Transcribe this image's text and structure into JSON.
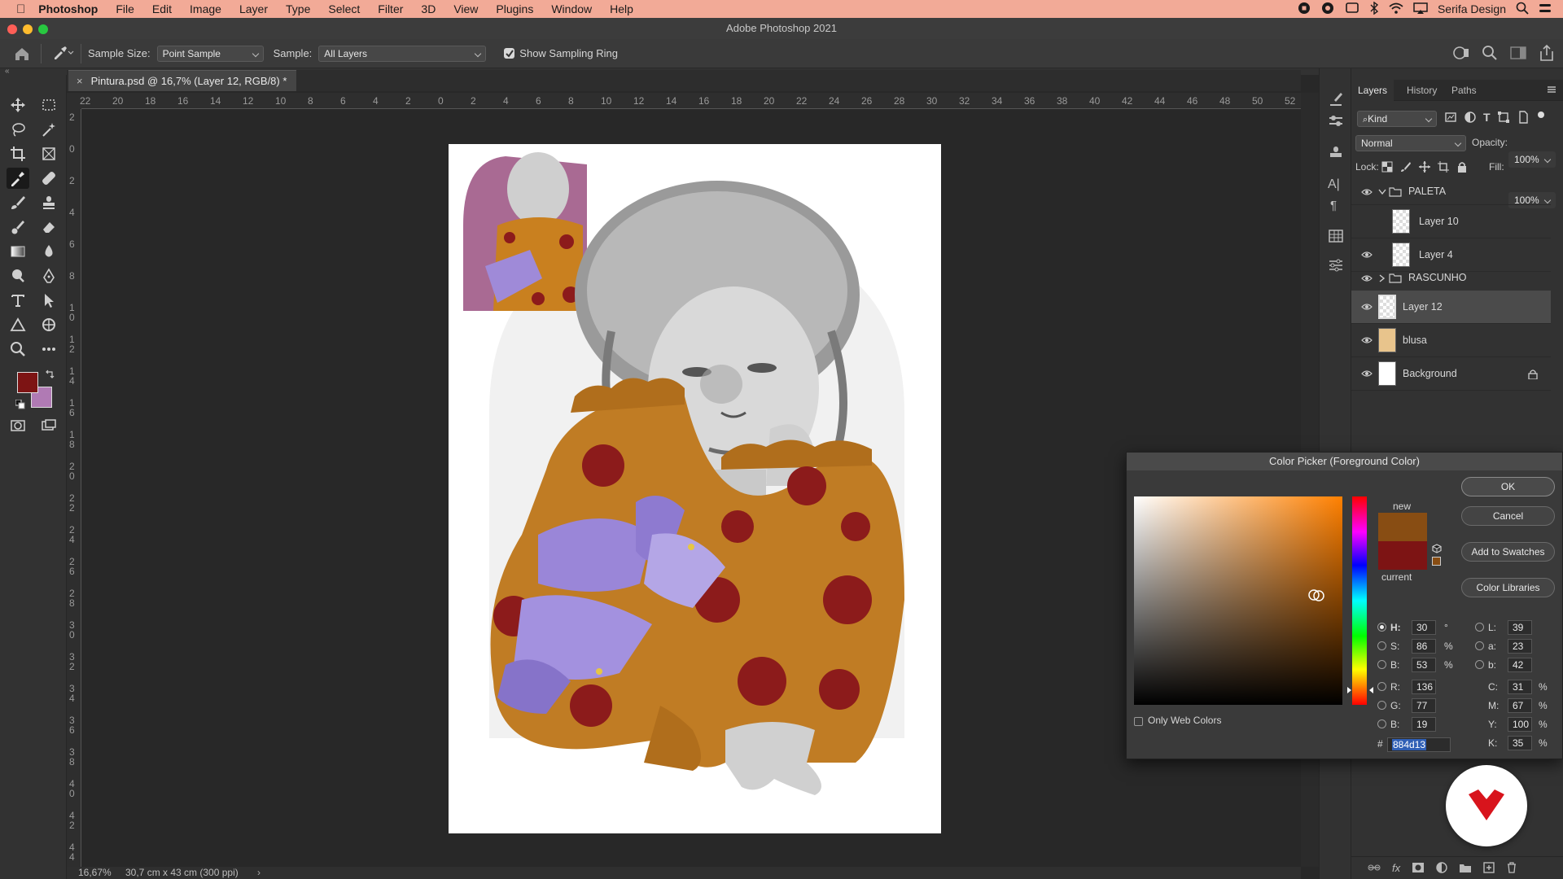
{
  "menubar": {
    "app_name": "Photoshop",
    "items": [
      "File",
      "Edit",
      "Image",
      "Layer",
      "Type",
      "Select",
      "Filter",
      "3D",
      "View",
      "Plugins",
      "Window",
      "Help"
    ],
    "user": "Serifa Design"
  },
  "window": {
    "title": "Adobe Photoshop 2021"
  },
  "options": {
    "sample_size_label": "Sample Size:",
    "sample_size_value": "Point Sample",
    "sample_label": "Sample:",
    "sample_value": "All Layers",
    "show_ring_label": "Show Sampling Ring",
    "show_ring_checked": true
  },
  "document": {
    "tab_label": "Pintura.psd @ 16,7% (Layer 12, RGB/8) *",
    "zoom": "16,67%",
    "size_info": "30,7 cm x 43 cm (300 ppi)"
  },
  "ruler": {
    "h_labels": [
      "22",
      "20",
      "18",
      "16",
      "14",
      "12",
      "10",
      "8",
      "6",
      "4",
      "2",
      "0",
      "2",
      "4",
      "6",
      "8",
      "10",
      "12",
      "14",
      "16",
      "18",
      "20",
      "22",
      "24",
      "26",
      "28",
      "30",
      "32",
      "34",
      "36",
      "38",
      "40",
      "42",
      "44",
      "46",
      "48",
      "50",
      "52"
    ],
    "v_labels": [
      "2",
      "0",
      "2",
      "4",
      "6",
      "8",
      "1 0",
      "1 2",
      "1 4",
      "1 6",
      "1 8",
      "2 0",
      "2 2",
      "2 4",
      "2 6",
      "2 8",
      "3 0",
      "3 2",
      "3 4",
      "3 6",
      "3 8",
      "4 0",
      "4 2",
      "4 4"
    ]
  },
  "tools": {
    "foreground_color": "#7d1414",
    "background_color": "#b07ab4"
  },
  "panel": {
    "tabs": [
      "Layers",
      "History",
      "Paths"
    ],
    "filter_label": "Kind",
    "blend_mode": "Normal",
    "opacity_label": "Opacity:",
    "opacity_value": "100%",
    "lock_label": "Lock:",
    "fill_label": "Fill:",
    "fill_value": "100%",
    "layers": [
      {
        "name": "PALETA",
        "type": "group",
        "expanded": true,
        "visible": true
      },
      {
        "name": "Layer 10",
        "type": "layer",
        "visible": false
      },
      {
        "name": "Layer 4",
        "type": "layer",
        "visible": true
      },
      {
        "name": "RASCUNHO",
        "type": "group",
        "expanded": false,
        "visible": true
      },
      {
        "name": "Layer 12",
        "type": "layer",
        "visible": true,
        "selected": true
      },
      {
        "name": "blusa",
        "type": "layer",
        "visible": true
      },
      {
        "name": "Background",
        "type": "layer",
        "visible": true,
        "locked": true
      }
    ]
  },
  "color_picker": {
    "title": "Color Picker (Foreground Color)",
    "new_label": "new",
    "current_label": "current",
    "new_color": "#884d13",
    "current_color": "#7d1414",
    "buttons": {
      "ok": "OK",
      "cancel": "Cancel",
      "add_swatches": "Add to Swatches",
      "libraries": "Color Libraries"
    },
    "only_web_label": "Only Web Colors",
    "hsb": {
      "H": "30",
      "S": "86",
      "B": "53"
    },
    "rgb": {
      "R": "136",
      "G": "77",
      "B": "19"
    },
    "lab": {
      "L": "39",
      "a": "23",
      "b": "42"
    },
    "cmyk": {
      "C": "31",
      "M": "67",
      "Y": "100",
      "K": "35"
    },
    "hex_label": "#",
    "hex": "884d13",
    "units": {
      "deg": "°",
      "pct": "%"
    }
  }
}
